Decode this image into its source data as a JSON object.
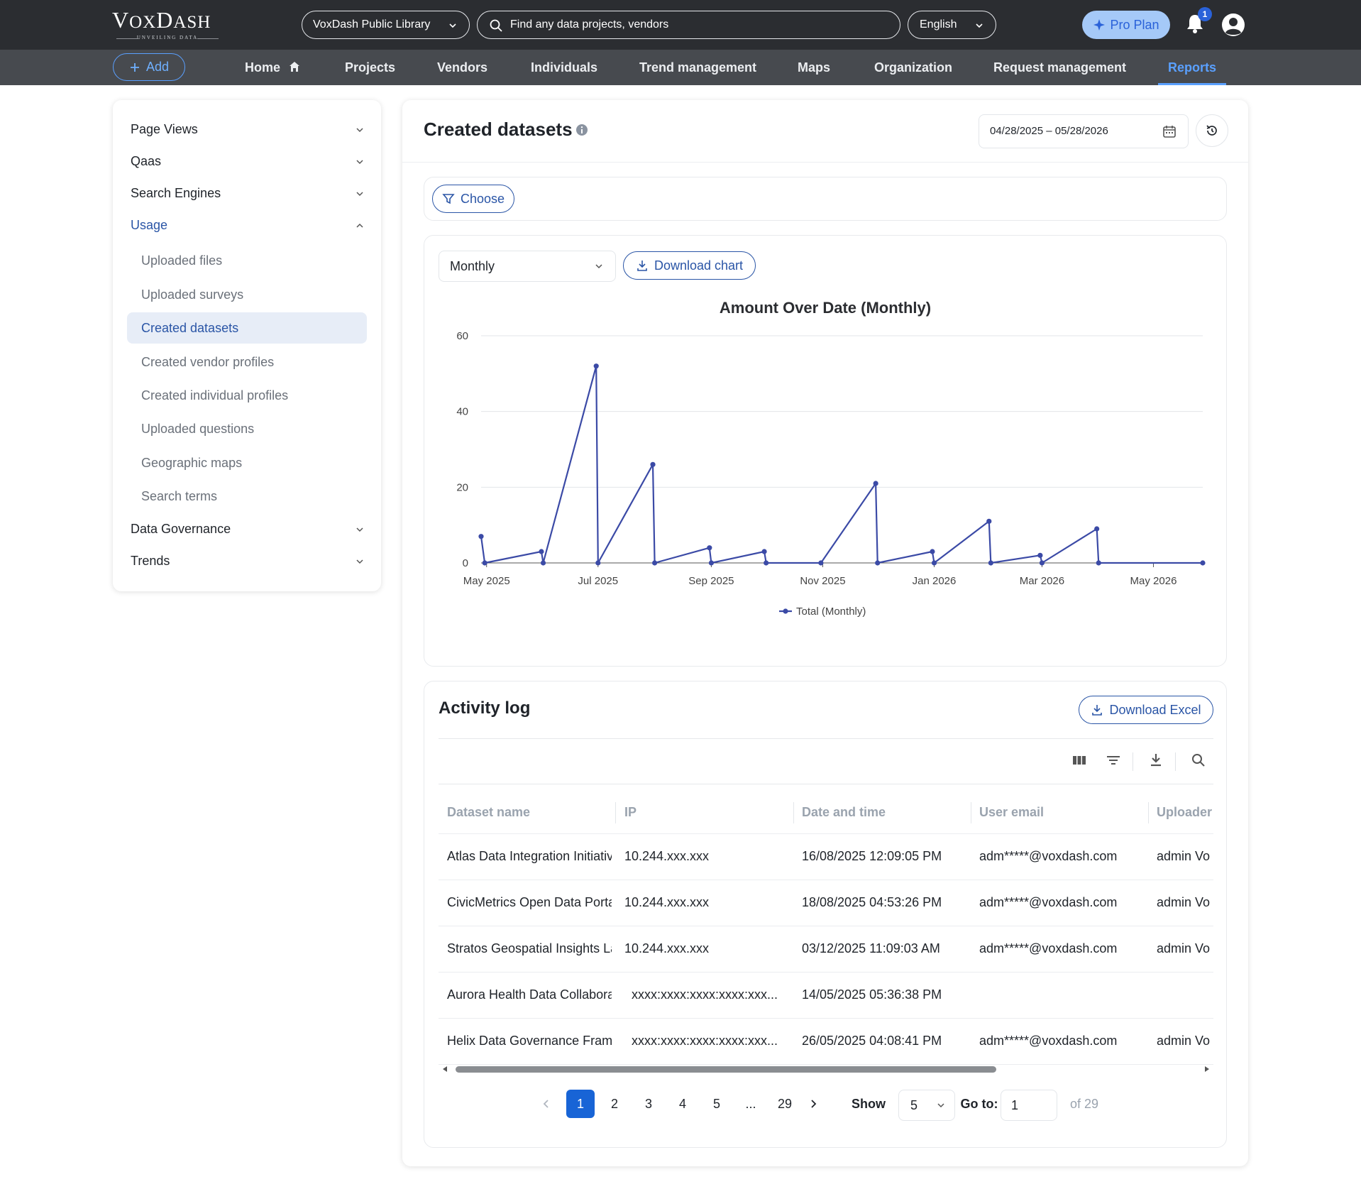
{
  "brand": {
    "name": "VoxDash",
    "tagline": "UNVEILING DATA"
  },
  "topbar": {
    "library": "VoxDash Public Library",
    "search_placeholder": "Find any data projects, vendors",
    "language": "English",
    "pro_plan": "Pro Plan",
    "notification_count": "1"
  },
  "nav": {
    "add": "Add",
    "items": [
      "Home",
      "Projects",
      "Vendors",
      "Individuals",
      "Trend management",
      "Maps",
      "Organization",
      "Request management",
      "Reports"
    ],
    "active": "Reports"
  },
  "sidebar": {
    "groups": [
      "Page Views",
      "Qaas",
      "Search Engines",
      "Usage",
      "Data Governance",
      "Trends"
    ],
    "usage_items": [
      "Uploaded files",
      "Uploaded surveys",
      "Created datasets",
      "Created vendor profiles",
      "Created individual profiles",
      "Uploaded questions",
      "Geographic maps",
      "Search terms"
    ],
    "active_item": "Created datasets"
  },
  "main": {
    "title": "Created datasets",
    "date_range": "04/28/2025 – 05/28/2026",
    "choose": "Choose",
    "period": "Monthly",
    "download_chart": "Download chart"
  },
  "chart_data": {
    "type": "line",
    "title": "Amount Over Date (Monthly)",
    "xlabel": "",
    "ylabel": "",
    "ylim": [
      0,
      60
    ],
    "y_ticks": [
      0,
      20,
      40,
      60
    ],
    "x_ticks": [
      "May 2025",
      "Jul 2025",
      "Sep 2025",
      "Nov 2025",
      "Jan 2026",
      "Mar 2026",
      "May 2026"
    ],
    "grid": true,
    "legend": "bottom",
    "series": [
      {
        "name": "Total (Monthly)",
        "color": "#3b4aa6",
        "points": [
          [
            "2025-04-28",
            7
          ],
          [
            "2025-04-30",
            0
          ],
          [
            "2025-05-31",
            3
          ],
          [
            "2025-06-01",
            0
          ],
          [
            "2025-06-30",
            52
          ],
          [
            "2025-07-01",
            0
          ],
          [
            "2025-07-31",
            26
          ],
          [
            "2025-08-01",
            0
          ],
          [
            "2025-08-31",
            4
          ],
          [
            "2025-09-01",
            0
          ],
          [
            "2025-09-30",
            3
          ],
          [
            "2025-10-01",
            0
          ],
          [
            "2025-10-31",
            0
          ],
          [
            "2025-11-30",
            21
          ],
          [
            "2025-12-01",
            0
          ],
          [
            "2025-12-31",
            3
          ],
          [
            "2026-01-01",
            0
          ],
          [
            "2026-01-31",
            11
          ],
          [
            "2026-02-01",
            0
          ],
          [
            "2026-02-28",
            2
          ],
          [
            "2026-03-01",
            0
          ],
          [
            "2026-03-31",
            9
          ],
          [
            "2026-04-01",
            0
          ],
          [
            "2026-05-28",
            0
          ]
        ]
      }
    ]
  },
  "activity_log": {
    "title": "Activity log",
    "download_excel": "Download Excel",
    "columns": [
      "Dataset name",
      "IP",
      "Date and time",
      "User email",
      "Uploader"
    ],
    "rows": [
      [
        "Atlas Data Integration Initiative",
        "10.244.xxx.xxx",
        "16/08/2025 12:09:05 PM",
        "adm*****@voxdash.com",
        "admin Vo"
      ],
      [
        "CivicMetrics Open Data Portal",
        "10.244.xxx.xxx",
        "18/08/2025 04:53:26 PM",
        "adm*****@voxdash.com",
        "admin Vo"
      ],
      [
        "Stratos Geospatial Insights Lab",
        "10.244.xxx.xxx",
        "03/12/2025 11:09:03 AM",
        "adm*****@voxdash.com",
        "admin Vo"
      ],
      [
        "Aurora Health Data Collaboratic",
        "xxxx:xxxx:xxxx:xxxx:xxx...",
        "14/05/2025 05:36:38 PM",
        "",
        ""
      ],
      [
        "Helix Data Governance Framewc",
        "xxxx:xxxx:xxxx:xxxx:xxx...",
        "26/05/2025 04:08:41 PM",
        "adm*****@voxdash.com",
        "admin Vo"
      ]
    ]
  },
  "pagination": {
    "pages": [
      "1",
      "2",
      "3",
      "4",
      "5",
      "...",
      "29"
    ],
    "current": "1",
    "show_label": "Show",
    "show_value": "5",
    "goto_label": "Go to:",
    "goto_value": "1",
    "of_label": "of 29"
  }
}
